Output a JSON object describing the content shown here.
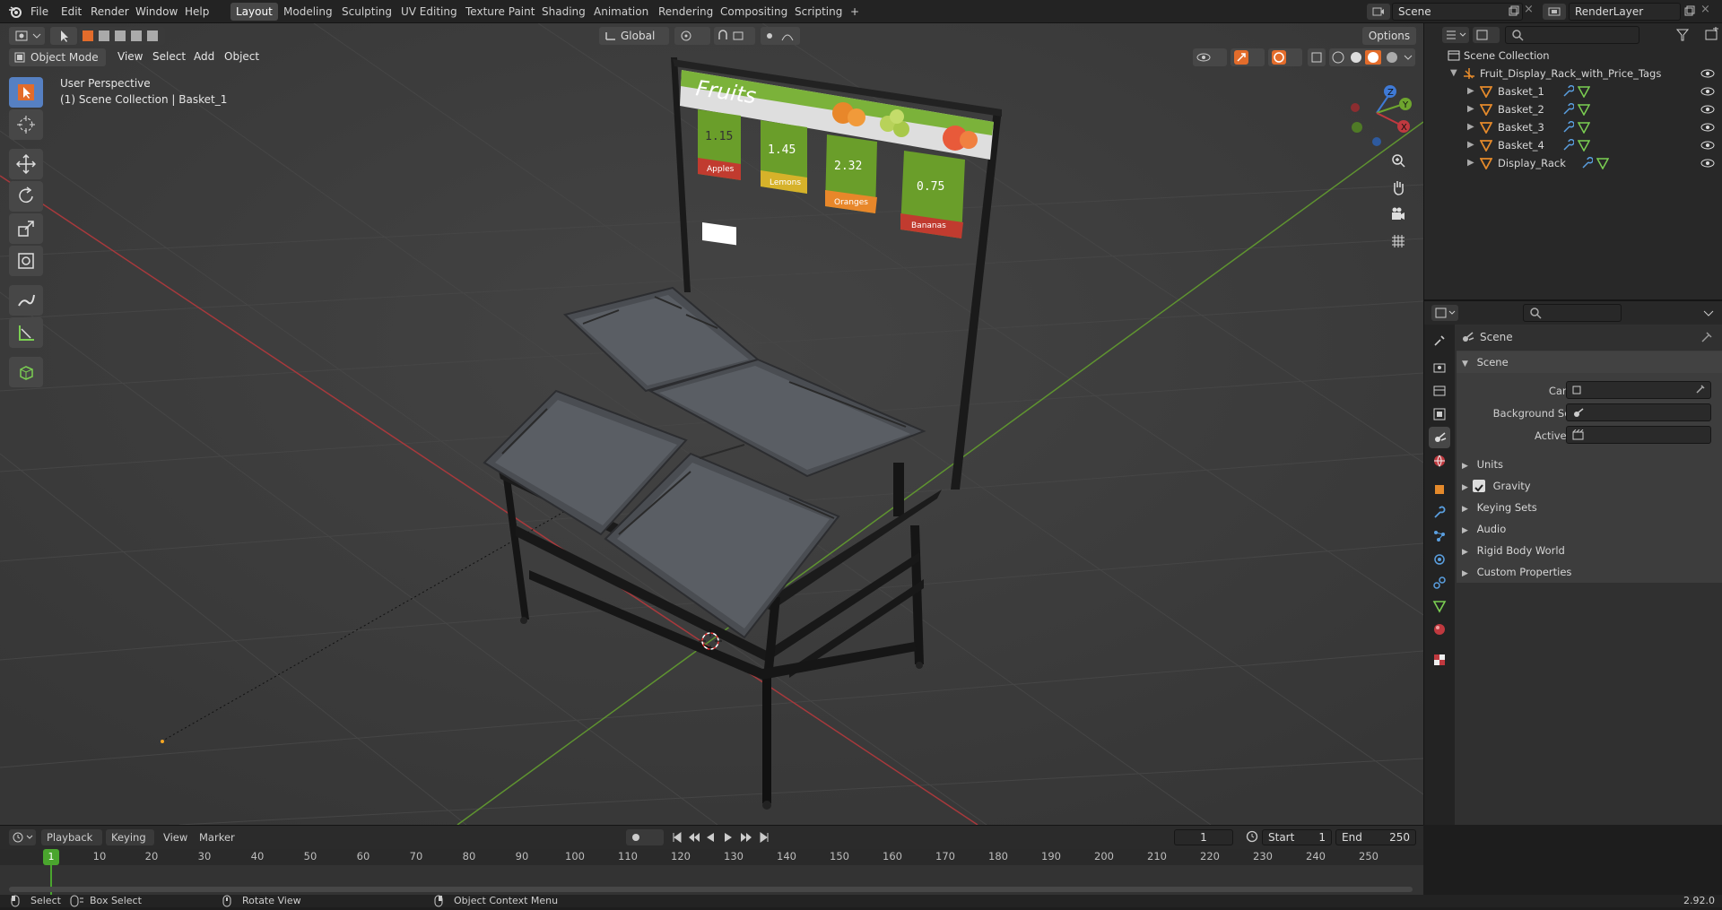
{
  "topbar": {
    "menus": [
      "File",
      "Edit",
      "Render",
      "Window",
      "Help"
    ],
    "workspaces": [
      "Layout",
      "Modeling",
      "Sculpting",
      "UV Editing",
      "Texture Paint",
      "Shading",
      "Animation",
      "Rendering",
      "Compositing",
      "Scripting"
    ],
    "scene_name": "Scene",
    "render_layer": "RenderLayer"
  },
  "viewport": {
    "mode": "Object Mode",
    "menus": [
      "View",
      "Select",
      "Add",
      "Object"
    ],
    "transform_orientation": "Global",
    "options_label": "Options",
    "overlay_title": "User Perspective",
    "overlay_subtitle": "(1) Scene Collection | Basket_1",
    "sign_title": "Fruits",
    "price_tags": [
      {
        "price": "1.15",
        "name": "Apples"
      },
      {
        "price": "1.45",
        "name": "Lemons"
      },
      {
        "price": "2.32",
        "name": "Oranges"
      },
      {
        "price": "0.75",
        "name": "Bananas"
      }
    ],
    "gizmo": {
      "x": "X",
      "y": "Y",
      "z": "Z"
    }
  },
  "outliner": {
    "root": "Scene Collection",
    "collection": "Fruit_Display_Rack_with_Price_Tags",
    "objects": [
      "Basket_1",
      "Basket_2",
      "Basket_3",
      "Basket_4",
      "Display_Rack"
    ]
  },
  "properties": {
    "context": "Scene",
    "panel_title": "Scene",
    "fields": {
      "camera": "Camera",
      "background_scene": "Background Scene",
      "active_clip": "Active Clip"
    },
    "subpanels": [
      "Units",
      "Gravity",
      "Keying Sets",
      "Audio",
      "Rigid Body World",
      "Custom Properties"
    ],
    "gravity_checked": true
  },
  "timeline": {
    "menus": [
      "Playback",
      "Keying",
      "View",
      "Marker"
    ],
    "current_frame": "1",
    "start_label": "Start",
    "start": "1",
    "end_label": "End",
    "end": "250",
    "ticks": [
      "10",
      "20",
      "30",
      "40",
      "50",
      "60",
      "70",
      "80",
      "90",
      "100",
      "110",
      "120",
      "130",
      "140",
      "150",
      "160",
      "170",
      "180",
      "190",
      "200",
      "210",
      "220",
      "230",
      "240",
      "250"
    ]
  },
  "statusbar": {
    "select": "Select",
    "box_select": "Box Select",
    "rotate_view": "Rotate View",
    "context_menu": "Object Context Menu",
    "version": "2.92.0"
  },
  "colors": {
    "accent": "#5680c2",
    "x_axis": "#c0393f",
    "y_axis": "#6ea52e",
    "z_axis": "#3f7ad6",
    "object_orange": "#e58a2b"
  }
}
